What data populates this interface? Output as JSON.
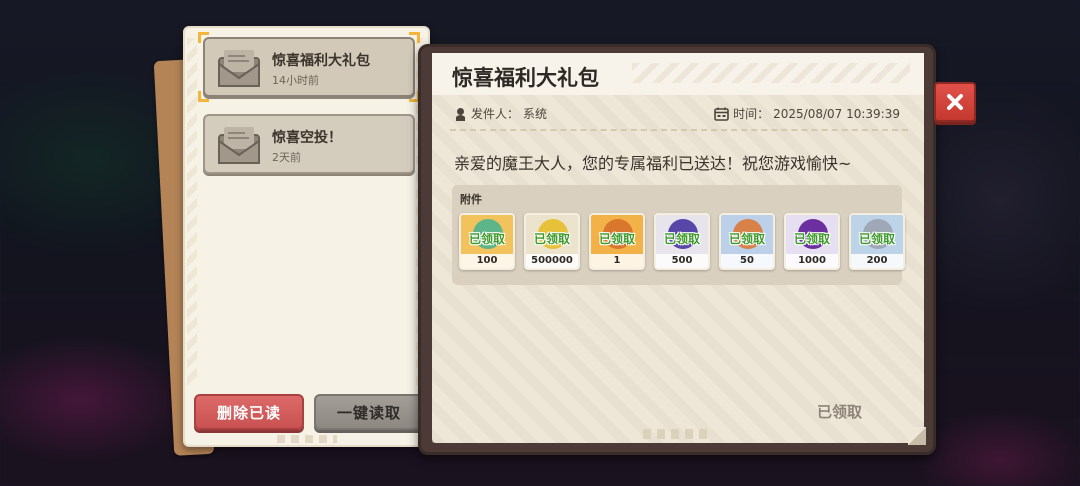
{
  "mail_list": {
    "items": [
      {
        "title": "惊喜福利大礼包",
        "time": "14小时前",
        "selected": true
      },
      {
        "title": "惊喜空投！",
        "time": "2天前",
        "selected": false
      }
    ],
    "delete_read_label": "删除已读",
    "read_all_label": "一键读取"
  },
  "detail": {
    "title": "惊喜福利大礼包",
    "sender_label": "发件人：",
    "sender": "系统",
    "time_label": "时间：",
    "time": "2025/08/07 10:39:39",
    "body": "亲爱的魔王大人，您的专属福利已送达！祝您游戏愉快~",
    "attachments_label": "附件",
    "attachments": [
      {
        "claimed": "已领取",
        "qty": "100",
        "bg": "#f2c25c",
        "icon": "green-gem-icon",
        "color": "#5fb58a"
      },
      {
        "claimed": "已领取",
        "qty": "500000",
        "bg": "#ece3cc",
        "icon": "gold-coin-icon",
        "color": "#e7c13a"
      },
      {
        "claimed": "已领取",
        "qty": "1",
        "bg": "#f2b248",
        "icon": "orange-egg-icon",
        "color": "#d9772f"
      },
      {
        "claimed": "已领取",
        "qty": "500",
        "bg": "#e7e4ec",
        "icon": "purple-potion-icon",
        "color": "#5846a8"
      },
      {
        "claimed": "已领取",
        "qty": "50",
        "bg": "#bcd0ea",
        "icon": "orange-egg-icon",
        "color": "#d8824a"
      },
      {
        "claimed": "已领取",
        "qty": "1000",
        "bg": "#e6dff2",
        "icon": "purple-cat-icon",
        "color": "#6b2fa0"
      },
      {
        "claimed": "已领取",
        "qty": "200",
        "bg": "#bcd3e8",
        "icon": "silver-crystal-icon",
        "color": "#9fa8b6"
      }
    ],
    "status": "已领取"
  },
  "close_icon": "close-icon"
}
